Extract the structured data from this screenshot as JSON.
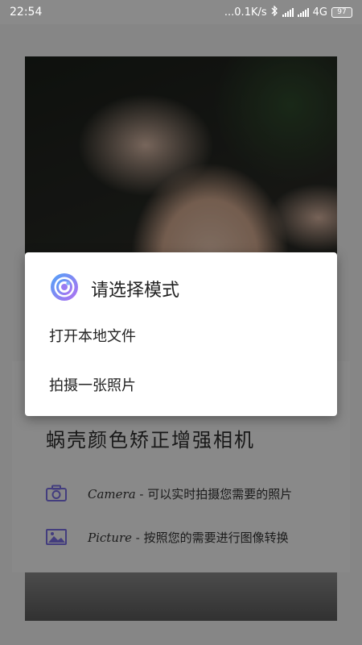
{
  "status_bar": {
    "time": "22:54",
    "network_speed": "...0.1K/s",
    "network_type": "4G",
    "battery": "97"
  },
  "app": {
    "card_title": "蜗壳颜色矫正增强相机",
    "features": [
      {
        "name": "Camera",
        "desc": " - 可以实时拍摄您需要的照片",
        "icon": "camera-icon"
      },
      {
        "name": "Picture",
        "desc": " - 按照您的需要进行图像转换",
        "icon": "picture-icon"
      }
    ],
    "accent_color": "#7b6fe6"
  },
  "dialog": {
    "title": "请选择模式",
    "options": [
      "打开本地文件",
      "拍摄一张照片"
    ]
  }
}
